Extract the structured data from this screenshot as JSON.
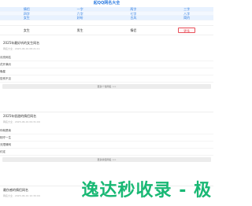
{
  "header": {
    "title": "起QQ网名大全"
  },
  "categories": [
    [
      "情侣",
      "一字",
      "两字",
      "三字"
    ],
    [
      "四字",
      "六字",
      "七字",
      "八字"
    ],
    [
      "女生",
      "好听",
      "古风",
      "简约"
    ]
  ],
  "gender_tabs": [
    {
      "label": "女生",
      "active": false
    },
    {
      "label": "男生",
      "active": false
    },
    {
      "label": "情侣",
      "active": false
    },
    {
      "label": "更多",
      "active": true
    }
  ],
  "cards": [
    {
      "title": "2025年最好听的女生网名",
      "meta": "网名大全 · 2025-06-19 08:21:11",
      "items": [
        "月亮网名",
        "花开满月",
        "晚星",
        "告别不见"
      ],
      "more": "更多个性网名 >>"
    },
    {
      "title": "2025年很甜的情侣网名",
      "meta": "网名大全 · 2025-06-19 09:31:09",
      "items": [
        "你就是我",
        "相守一生",
        "无限情网",
        "约定"
      ],
      "more": "更多情侣网名 >>"
    },
    {
      "title": "最伤感的情侣网名",
      "meta": "网名大全 · 2025-06-19 10:30:09",
      "items": [],
      "more": ""
    }
  ],
  "watermark": {
    "text": "逸达秒收录 - 极",
    "color": "#19b874"
  }
}
